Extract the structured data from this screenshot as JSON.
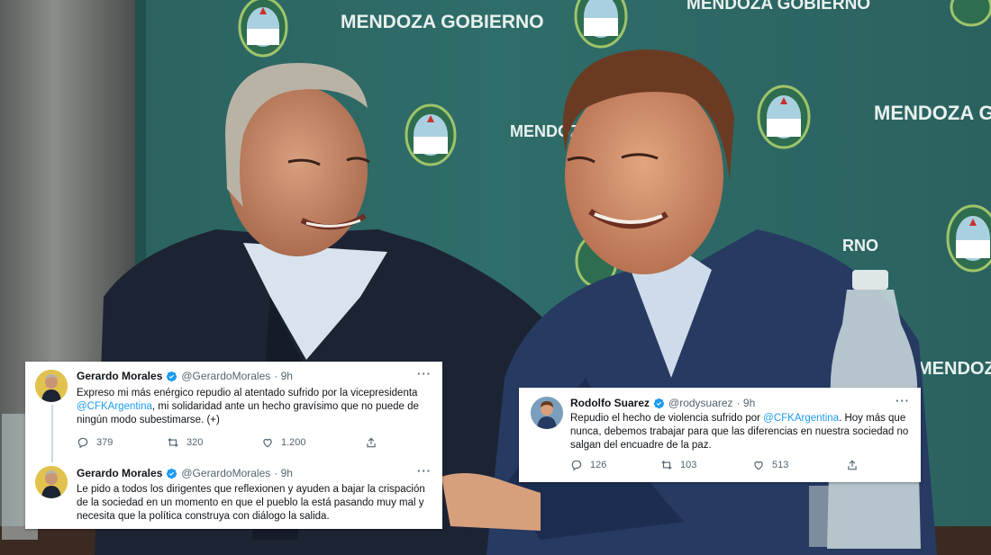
{
  "background": {
    "wall_text": [
      "MENDOZA GOBIERNO",
      "MENDOZA GOBIERNO",
      "MENDOZA G",
      "MENDOZ",
      "RNO",
      "MENDOZA GOBI"
    ],
    "colors": {
      "wall": "#2f6d6a",
      "wall_dark": "#204d4b",
      "suit_left": "#1c2434",
      "suit_right": "#263a62"
    }
  },
  "tweets_left": [
    {
      "name": "Gerardo Morales",
      "handle": "@GerardoMorales",
      "time": "· 9h",
      "text_before": "Expreso mi más enérgico repudio al atentado sufrido por la vicepresidenta ",
      "mention": "@CFKArgentina",
      "text_after": ", mi solidaridad ante un hecho gravísimo que no puede de ningún modo subestimarse. (+)",
      "replies": "379",
      "retweets": "320",
      "likes": "1.200"
    },
    {
      "name": "Gerardo Morales",
      "handle": "@GerardoMorales",
      "time": "· 9h",
      "text": "Le pido a todos los dirigentes que reflexionen y ayuden a bajar la crispación de la sociedad en un momento en que el pueblo la está pasando muy mal y necesita que la política construya con diálogo la salida."
    }
  ],
  "tweet_right": {
    "name": "Rodolfo Suarez",
    "handle": "@rodysuarez",
    "time": "· 9h",
    "text_before": "Repudio el hecho de violencia sufrido por ",
    "mention": "@CFKArgentina",
    "text_after": ". Hoy más que nunca, debemos trabajar para que las diferencias en nuestra sociedad no salgan del encuadre de la paz.",
    "replies": "126",
    "retweets": "103",
    "likes": "513"
  },
  "icons": {
    "verified": "verified-badge-icon",
    "more": "more-options-icon",
    "reply": "reply-icon",
    "retweet": "retweet-icon",
    "like": "like-icon",
    "share": "share-icon"
  },
  "ui_colors": {
    "accent": "#1d9bf0",
    "text": "#0f1419",
    "muted": "#536471"
  },
  "more_glyph": "···"
}
